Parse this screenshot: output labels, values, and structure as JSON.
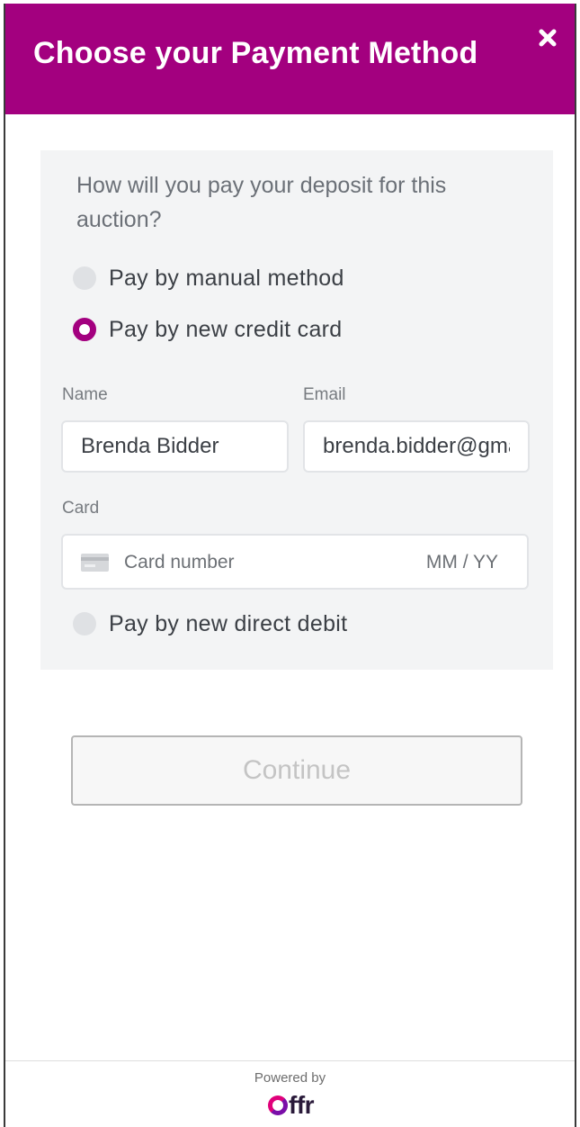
{
  "modal": {
    "title": "Choose your Payment Method",
    "close_icon": "close-icon"
  },
  "form": {
    "question": "How will you pay your deposit for this auction?",
    "options": [
      {
        "label": "Pay by manual method",
        "selected": false
      },
      {
        "label": "Pay by new credit card",
        "selected": true
      },
      {
        "label": "Pay by new direct debit",
        "selected": false
      }
    ],
    "name_label": "Name",
    "name_value": "Brenda Bidder",
    "email_label": "Email",
    "email_value": "brenda.bidder@gmail.com",
    "card_label": "Card",
    "card_number_placeholder": "Card number",
    "card_expiry_placeholder": "MM / YY",
    "card_icon": "credit-card-icon"
  },
  "actions": {
    "continue_label": "Continue"
  },
  "footer": {
    "powered_by": "Powered by",
    "brand": "ffr",
    "brand_colors": {
      "primary": "#e0007a",
      "secondary": "#7a0ea8"
    }
  },
  "colors": {
    "accent": "#a3007f",
    "panel_bg": "#f3f4f5"
  }
}
